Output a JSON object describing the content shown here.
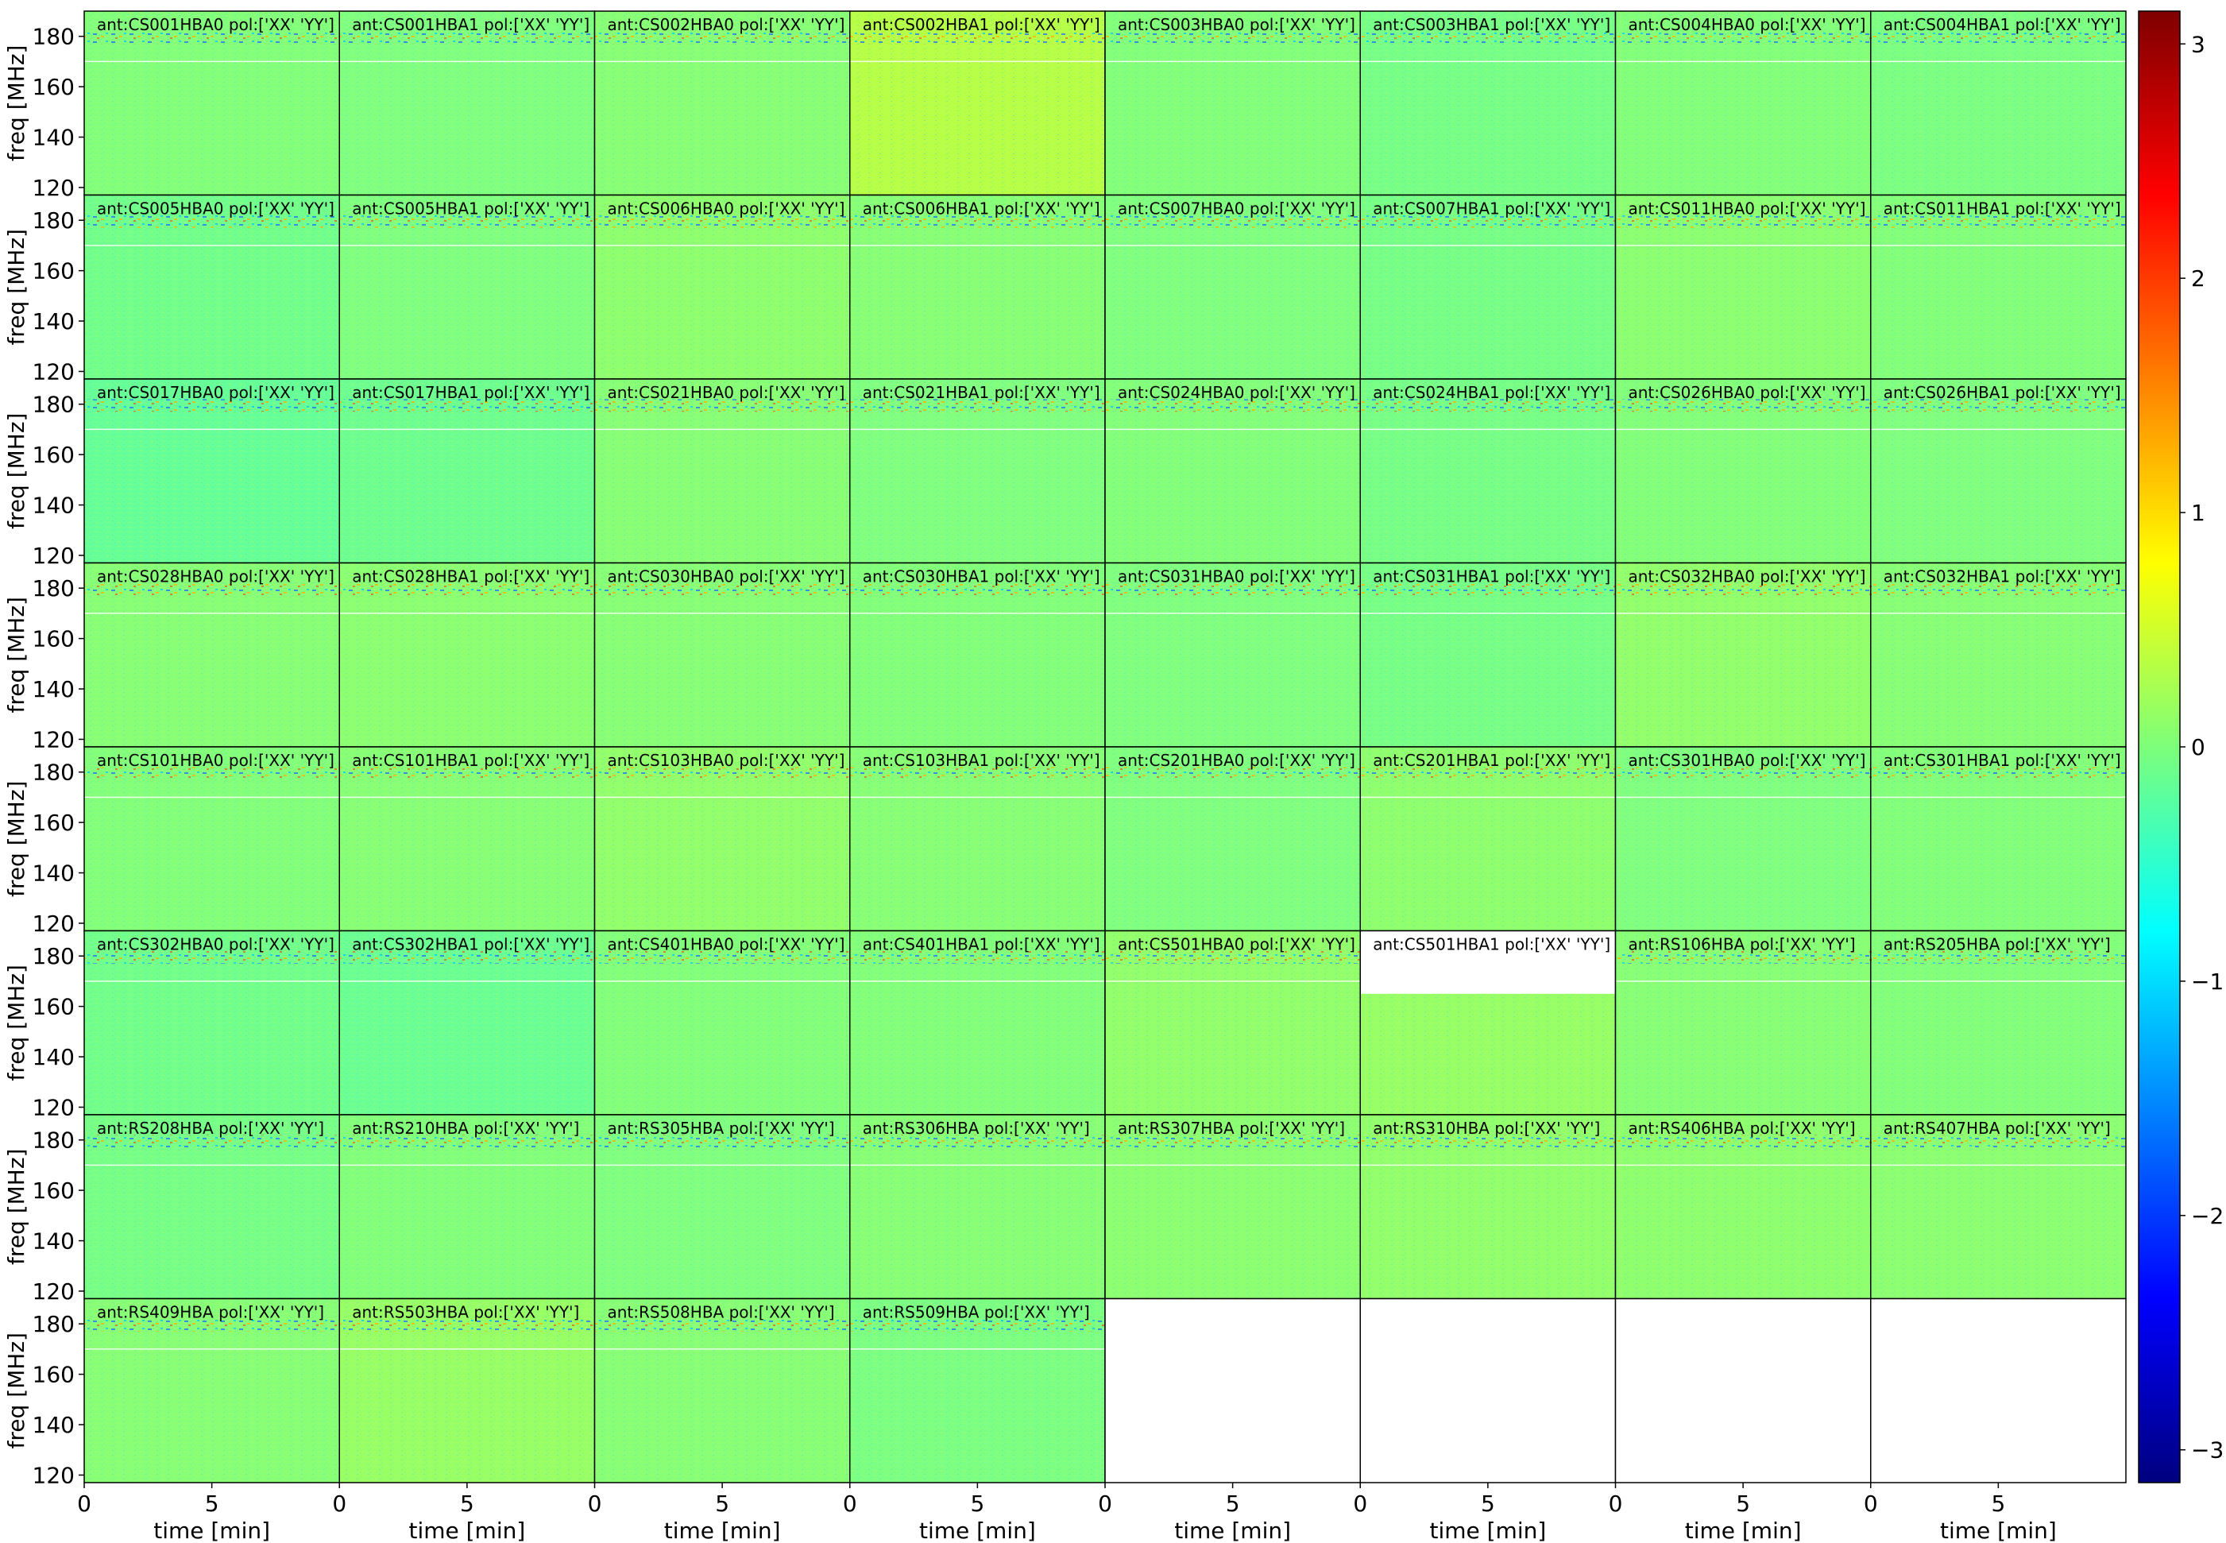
{
  "chart_data": {
    "type": "heatmap",
    "layout": {
      "rows": 8,
      "cols": 8
    },
    "xlabel": "time [min]",
    "ylabel": "freq [MHz]",
    "xlim": [
      0,
      10
    ],
    "ylim": [
      117,
      190
    ],
    "xticks": [
      0,
      5
    ],
    "yticks": [
      120,
      140,
      160,
      180
    ],
    "colormap": "jet",
    "colorbar": {
      "min": -3.14,
      "max": 3.14,
      "ticks": [
        -3,
        -2,
        -1,
        0,
        1,
        2,
        3
      ],
      "tick_labels": [
        "−3",
        "−2",
        "−1",
        "0",
        "1",
        "2",
        "3"
      ]
    },
    "flagged_channel_mhz": 170,
    "panels": [
      {
        "title": "ant:CS001HBA0 pol:['XX' 'YY']",
        "mean_value": 0.02
      },
      {
        "title": "ant:CS001HBA1 pol:['XX' 'YY']",
        "mean_value": 0.0
      },
      {
        "title": "ant:CS002HBA0 pol:['XX' 'YY']",
        "mean_value": 0.05
      },
      {
        "title": "ant:CS002HBA1 pol:['XX' 'YY']",
        "mean_value": 0.35
      },
      {
        "title": "ant:CS003HBA0 pol:['XX' 'YY']",
        "mean_value": 0.02
      },
      {
        "title": "ant:CS003HBA1 pol:['XX' 'YY']",
        "mean_value": -0.05
      },
      {
        "title": "ant:CS004HBA0 pol:['XX' 'YY']",
        "mean_value": 0.03
      },
      {
        "title": "ant:CS004HBA1 pol:['XX' 'YY']",
        "mean_value": -0.02
      },
      {
        "title": "ant:CS005HBA0 pol:['XX' 'YY']",
        "mean_value": -0.08
      },
      {
        "title": "ant:CS005HBA1 pol:['XX' 'YY']",
        "mean_value": 0.0
      },
      {
        "title": "ant:CS006HBA0 pol:['XX' 'YY']",
        "mean_value": 0.1
      },
      {
        "title": "ant:CS006HBA1 pol:['XX' 'YY']",
        "mean_value": 0.05
      },
      {
        "title": "ant:CS007HBA0 pol:['XX' 'YY']",
        "mean_value": 0.0
      },
      {
        "title": "ant:CS007HBA1 pol:['XX' 'YY']",
        "mean_value": -0.05
      },
      {
        "title": "ant:CS011HBA0 pol:['XX' 'YY']",
        "mean_value": 0.08
      },
      {
        "title": "ant:CS011HBA1 pol:['XX' 'YY']",
        "mean_value": 0.02
      },
      {
        "title": "ant:CS017HBA0 pol:['XX' 'YY']",
        "mean_value": -0.15
      },
      {
        "title": "ant:CS017HBA1 pol:['XX' 'YY']",
        "mean_value": -0.1
      },
      {
        "title": "ant:CS021HBA0 pol:['XX' 'YY']",
        "mean_value": 0.05
      },
      {
        "title": "ant:CS021HBA1 pol:['XX' 'YY']",
        "mean_value": 0.0
      },
      {
        "title": "ant:CS024HBA0 pol:['XX' 'YY']",
        "mean_value": 0.02
      },
      {
        "title": "ant:CS024HBA1 pol:['XX' 'YY']",
        "mean_value": -0.05
      },
      {
        "title": "ant:CS026HBA0 pol:['XX' 'YY']",
        "mean_value": 0.03
      },
      {
        "title": "ant:CS026HBA1 pol:['XX' 'YY']",
        "mean_value": 0.0
      },
      {
        "title": "ant:CS028HBA0 pol:['XX' 'YY']",
        "mean_value": 0.05
      },
      {
        "title": "ant:CS028HBA1 pol:['XX' 'YY']",
        "mean_value": 0.08
      },
      {
        "title": "ant:CS030HBA0 pol:['XX' 'YY']",
        "mean_value": 0.05
      },
      {
        "title": "ant:CS030HBA1 pol:['XX' 'YY']",
        "mean_value": 0.02
      },
      {
        "title": "ant:CS031HBA0 pol:['XX' 'YY']",
        "mean_value": 0.0
      },
      {
        "title": "ant:CS031HBA1 pol:['XX' 'YY']",
        "mean_value": -0.05
      },
      {
        "title": "ant:CS032HBA0 pol:['XX' 'YY']",
        "mean_value": 0.12
      },
      {
        "title": "ant:CS032HBA1 pol:['XX' 'YY']",
        "mean_value": 0.05
      },
      {
        "title": "ant:CS101HBA0 pol:['XX' 'YY']",
        "mean_value": 0.03
      },
      {
        "title": "ant:CS101HBA1 pol:['XX' 'YY']",
        "mean_value": 0.05
      },
      {
        "title": "ant:CS103HBA0 pol:['XX' 'YY']",
        "mean_value": 0.12
      },
      {
        "title": "ant:CS103HBA1 pol:['XX' 'YY']",
        "mean_value": 0.05
      },
      {
        "title": "ant:CS201HBA0 pol:['XX' 'YY']",
        "mean_value": 0.0
      },
      {
        "title": "ant:CS201HBA1 pol:['XX' 'YY']",
        "mean_value": 0.1
      },
      {
        "title": "ant:CS301HBA0 pol:['XX' 'YY']",
        "mean_value": 0.0
      },
      {
        "title": "ant:CS301HBA1 pol:['XX' 'YY']",
        "mean_value": 0.02
      },
      {
        "title": "ant:CS302HBA0 pol:['XX' 'YY']",
        "mean_value": -0.08
      },
      {
        "title": "ant:CS302HBA1 pol:['XX' 'YY']",
        "mean_value": -0.12
      },
      {
        "title": "ant:CS401HBA0 pol:['XX' 'YY']",
        "mean_value": 0.02
      },
      {
        "title": "ant:CS401HBA1 pol:['XX' 'YY']",
        "mean_value": 0.03
      },
      {
        "title": "ant:CS501HBA0 pol:['XX' 'YY']",
        "mean_value": 0.12
      },
      {
        "title": "ant:CS501HBA1 pol:['XX' 'YY']",
        "mean_value": 0.15,
        "blank_above_mhz": 165
      },
      {
        "title": "ant:RS106HBA pol:['XX' 'YY']",
        "mean_value": 0.05
      },
      {
        "title": "ant:RS205HBA pol:['XX' 'YY']",
        "mean_value": 0.02
      },
      {
        "title": "ant:RS208HBA pol:['XX' 'YY']",
        "mean_value": -0.05
      },
      {
        "title": "ant:RS210HBA pol:['XX' 'YY']",
        "mean_value": 0.02
      },
      {
        "title": "ant:RS305HBA pol:['XX' 'YY']",
        "mean_value": 0.0
      },
      {
        "title": "ant:RS306HBA pol:['XX' 'YY']",
        "mean_value": 0.05
      },
      {
        "title": "ant:RS307HBA pol:['XX' 'YY']",
        "mean_value": 0.08
      },
      {
        "title": "ant:RS310HBA pol:['XX' 'YY']",
        "mean_value": 0.12
      },
      {
        "title": "ant:RS406HBA pol:['XX' 'YY']",
        "mean_value": 0.1
      },
      {
        "title": "ant:RS407HBA pol:['XX' 'YY']",
        "mean_value": 0.08
      },
      {
        "title": "ant:RS409HBA pol:['XX' 'YY']",
        "mean_value": 0.05
      },
      {
        "title": "ant:RS503HBA pol:['XX' 'YY']",
        "mean_value": 0.15
      },
      {
        "title": "ant:RS508HBA pol:['XX' 'YY']",
        "mean_value": 0.05
      },
      {
        "title": "ant:RS509HBA pol:['XX' 'YY']",
        "mean_value": -0.02
      },
      null,
      null,
      null,
      null
    ]
  }
}
